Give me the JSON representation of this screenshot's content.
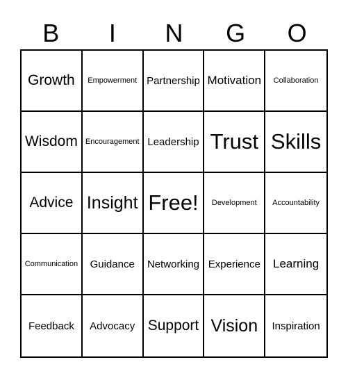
{
  "header": [
    "B",
    "I",
    "N",
    "G",
    "O"
  ],
  "cells": [
    [
      {
        "text": "Growth",
        "size": "m"
      },
      {
        "text": "Empowerment",
        "size": "xs"
      },
      {
        "text": "Partnership",
        "size": "sm"
      },
      {
        "text": "Motivation",
        "size": "s"
      },
      {
        "text": "Collaboration",
        "size": "xs"
      }
    ],
    [
      {
        "text": "Wisdom",
        "size": "m"
      },
      {
        "text": "Encouragement",
        "size": "xs"
      },
      {
        "text": "Leadership",
        "size": "sm"
      },
      {
        "text": "Trust",
        "size": "xl"
      },
      {
        "text": "Skills",
        "size": "xl"
      }
    ],
    [
      {
        "text": "Advice",
        "size": "m"
      },
      {
        "text": "Insight",
        "size": "l"
      },
      {
        "text": "Free!",
        "size": "xl"
      },
      {
        "text": "Development",
        "size": "xs"
      },
      {
        "text": "Accountability",
        "size": "xs"
      }
    ],
    [
      {
        "text": "Communication",
        "size": "xs"
      },
      {
        "text": "Guidance",
        "size": "sm"
      },
      {
        "text": "Networking",
        "size": "sm"
      },
      {
        "text": "Experience",
        "size": "sm"
      },
      {
        "text": "Learning",
        "size": "s"
      }
    ],
    [
      {
        "text": "Feedback",
        "size": "sm"
      },
      {
        "text": "Advocacy",
        "size": "sm"
      },
      {
        "text": "Support",
        "size": "m"
      },
      {
        "text": "Vision",
        "size": "l"
      },
      {
        "text": "Inspiration",
        "size": "sm"
      }
    ]
  ]
}
